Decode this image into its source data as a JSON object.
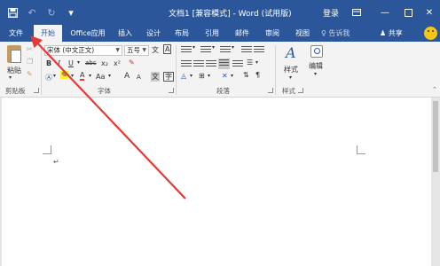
{
  "titlebar": {
    "title": "文档1 [兼容模式] - Word (试用版)",
    "login": "登录",
    "qa_save_icon": "save-icon",
    "qa_undo_icon": "undo-icon",
    "qa_redo_icon": "redo-icon",
    "qa_more_icon": "customize-quick-access-icon"
  },
  "tabs": {
    "file": "文件",
    "home": "开始",
    "office": "Office应用",
    "insert": "插入",
    "design": "设计",
    "layout": "布局",
    "references": "引用",
    "mailings": "邮件",
    "review": "审阅",
    "view": "视图",
    "tell_me": "告诉我",
    "share": "共享"
  },
  "ribbon": {
    "clipboard": {
      "paste_label": "粘贴",
      "group_label": "剪贴板"
    },
    "font": {
      "font_name": "宋体 (中文正文)",
      "font_size": "五号",
      "bold": "B",
      "italic": "I",
      "underline": "U",
      "strike": "abc",
      "subscript": "x₂",
      "superscript": "x²",
      "font_color_label": "A",
      "change_case": "Aa",
      "grow": "A",
      "shrink": "A",
      "wen": "文",
      "char_border": "A",
      "group_label": "字体"
    },
    "paragraph": {
      "group_label": "段落"
    },
    "styles": {
      "styles_label": "样式",
      "group_label": "样式"
    },
    "editing": {
      "editing_label": "编辑"
    }
  },
  "colors": {
    "brand": "#2b579a",
    "arrow": "#e53935"
  }
}
